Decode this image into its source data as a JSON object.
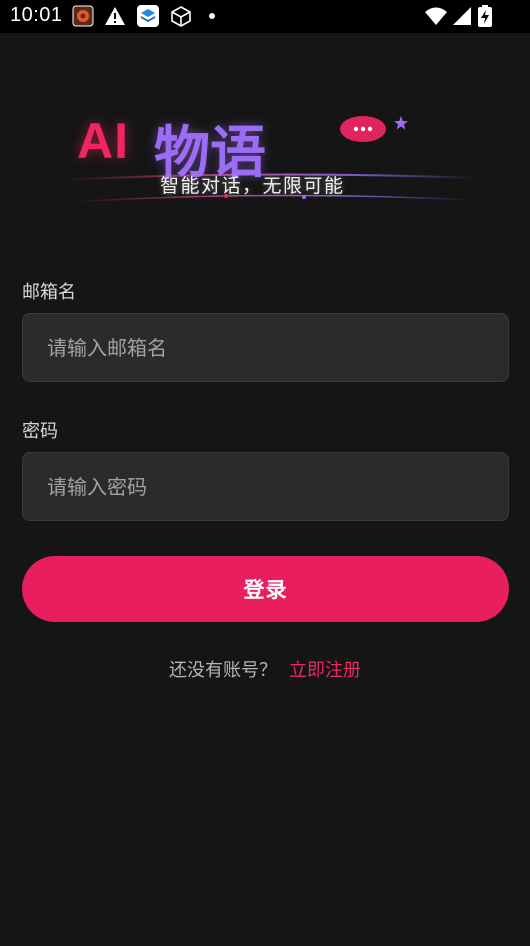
{
  "status_bar": {
    "time": "10:01",
    "icons": [
      "app-notification-icon",
      "warning-icon",
      "stack-app-icon",
      "box-icon",
      "dot-icon",
      "wifi-icon",
      "signal-icon",
      "battery-charging-icon"
    ]
  },
  "logo": {
    "ai_text": "AI",
    "name_text": "物语",
    "tagline": "智能对话，无限可能",
    "colors": {
      "ai": "#f0265f",
      "name": "#9d6cf5"
    }
  },
  "form": {
    "email_label": "邮箱名",
    "email_placeholder": "请输入邮箱名",
    "email_value": "",
    "password_label": "密码",
    "password_placeholder": "请输入密码",
    "password_value": "",
    "login_label": "登录"
  },
  "register": {
    "prompt": "还没有账号？",
    "link": "立即注册"
  },
  "theme": {
    "background": "#151515",
    "accent": "#e91e5f",
    "input_bg": "#2b2b2b"
  }
}
